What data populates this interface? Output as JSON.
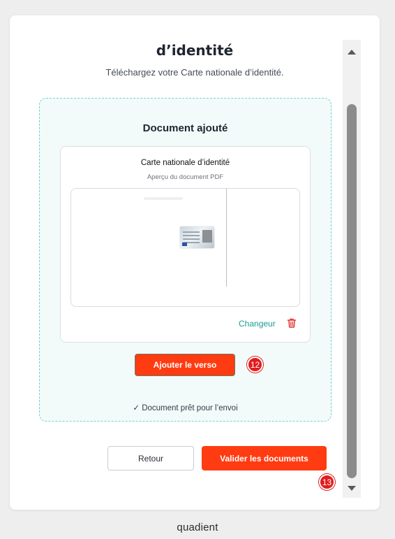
{
  "page": {
    "title": "d’identité",
    "subtitle": "Téléchargez votre Carte nationale d’identité."
  },
  "dropzone": {
    "title": "Document ajouté",
    "document": {
      "name": "Carte nationale d’identité",
      "preview_label": "Aperçu du document PDF",
      "change_label": "Changeur",
      "delete_icon": "trash-icon"
    },
    "add_back_button": "Ajouter le verso",
    "status_text": "✓ Document prêt pour l’envoi"
  },
  "footer": {
    "back_button": "Retour",
    "submit_button": "Valider les documents"
  },
  "annotations": {
    "badge_add_back": "12",
    "badge_scroll": "13"
  },
  "brand": {
    "logo_text": "quadient"
  },
  "colors": {
    "accent": "#ff3b12",
    "link": "#1a9c94",
    "dropzone_border": "#6fd3cf",
    "badge": "#e11d1d"
  }
}
